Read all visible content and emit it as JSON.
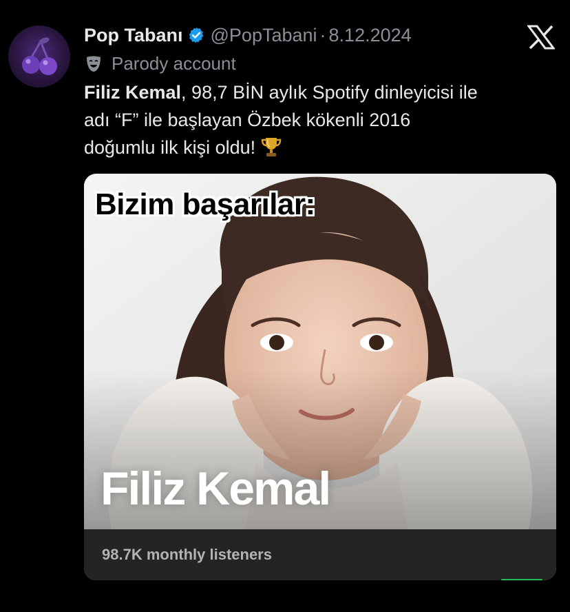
{
  "tweet": {
    "display_name": "Pop Tabanı",
    "handle": "@PopTabani",
    "separator": "·",
    "date": "8.12.2024",
    "label": "Parody account",
    "text_bold": "Filiz Kemal",
    "text_rest_line1": ", 98,7 BİN aylık Spotify dinleyicisi ile",
    "text_line2": "adı “F” ile başlayan Özbek kökenli 2016",
    "text_line3": "doğumlu ilk kişi oldu!",
    "icons": {
      "avatar": "cherries-avatar",
      "verified": "verified-badge-icon",
      "platform": "x-logo-icon",
      "label": "theater-mask-icon",
      "emoji": "trophy-icon"
    },
    "colors": {
      "background": "#000000",
      "text": "#e7e9ea",
      "muted": "#8b9096",
      "verified": "#1d9bf0",
      "spotify_green": "#1db954"
    }
  },
  "media": {
    "caption": "Bizim başarılar:",
    "artist_name": "Filiz Kemal",
    "listeners": "98.7K monthly listeners"
  }
}
